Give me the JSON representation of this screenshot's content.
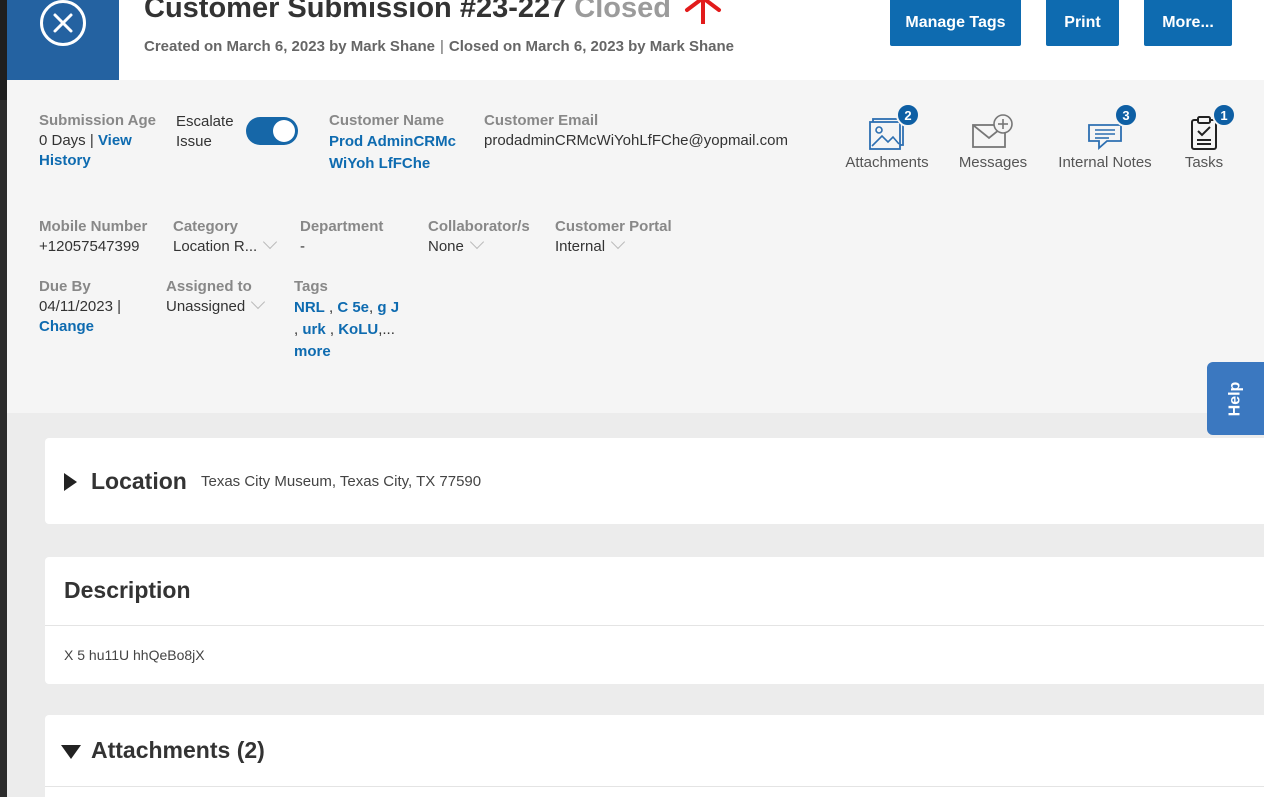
{
  "header": {
    "title": "Customer Submission #23-227",
    "status": "Closed",
    "created": "Created on March 6, 2023 by Mark Shane",
    "separator": "|",
    "closed": "Closed on March 6, 2023 by Mark Shane",
    "buttons": {
      "manage_tags": "Manage Tags",
      "print": "Print",
      "more": "More..."
    }
  },
  "info": {
    "submission_age": {
      "label": "Submission Age",
      "value": "0 Days",
      "sep": "|",
      "link": "View History"
    },
    "escalate": {
      "label": "Escalate Issue",
      "on": true
    },
    "customer_name": {
      "label": "Customer Name",
      "value": "Prod AdminCRMcWiYoh LfFChe"
    },
    "customer_email": {
      "label": "Customer Email",
      "value": "prodadminCRMcWiYohLfFChe@yopmail.com"
    },
    "mobile": {
      "label": "Mobile Number",
      "value": "+12057547399"
    },
    "category": {
      "label": "Category",
      "value": "Location R..."
    },
    "department": {
      "label": "Department",
      "value": "-"
    },
    "collaborators": {
      "label": "Collaborator/s",
      "value": "None"
    },
    "portal": {
      "label": "Customer Portal",
      "value": "Internal"
    },
    "due_by": {
      "label": "Due By",
      "value": "04/11/2023",
      "sep": "|",
      "link": "Change"
    },
    "assigned": {
      "label": "Assigned to",
      "value": "Unassigned"
    },
    "tags": {
      "label": "Tags",
      "items": [
        "NRL",
        "C 5e",
        "g J",
        "urk",
        "KoLU"
      ],
      "ellipsis": "...",
      "more": "more"
    }
  },
  "icons": [
    {
      "label": "Attachments",
      "count": "2"
    },
    {
      "label": "Messages"
    },
    {
      "label": "Internal Notes",
      "count": "3"
    },
    {
      "label": "Tasks",
      "count": "1"
    }
  ],
  "help": "Help",
  "location": {
    "title": "Location",
    "value": "Texas City Museum, Texas City, TX 77590"
  },
  "description": {
    "title": "Description",
    "text": "X 5 hu11U hhQeBo8jX"
  },
  "attachments": {
    "title": "Attachments (2)"
  }
}
